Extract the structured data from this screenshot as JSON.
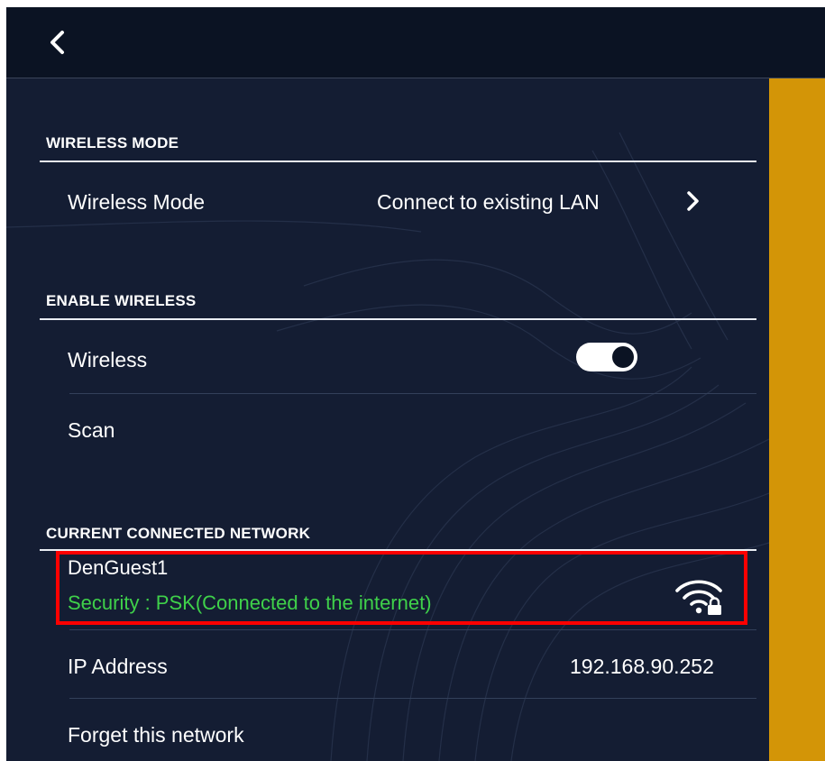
{
  "header": {
    "back_icon": "chevron-left-icon"
  },
  "sections": {
    "wireless_mode": {
      "title": "WIRELESS MODE",
      "label": "Wireless Mode",
      "value": "Connect to existing LAN",
      "chevron_icon": "chevron-right-icon"
    },
    "enable_wireless": {
      "title": "ENABLE WIRELESS",
      "wireless_label": "Wireless",
      "wireless_on": true,
      "scan_label": "Scan"
    },
    "current_network": {
      "title": "CURRENT CONNECTED NETWORK",
      "name": "DenGuest1",
      "security": "Security : PSK(Connected to the internet)",
      "signal_icon": "wifi-lock-icon",
      "ip_label": "IP Address",
      "ip_value": "192.168.90.252",
      "forget_label": "Forget this network"
    }
  },
  "colors": {
    "background": "#141d33",
    "topbar": "#0b1323",
    "accent": "#d39507",
    "connected_text": "#3fd14a",
    "highlight": "#ff0000"
  }
}
